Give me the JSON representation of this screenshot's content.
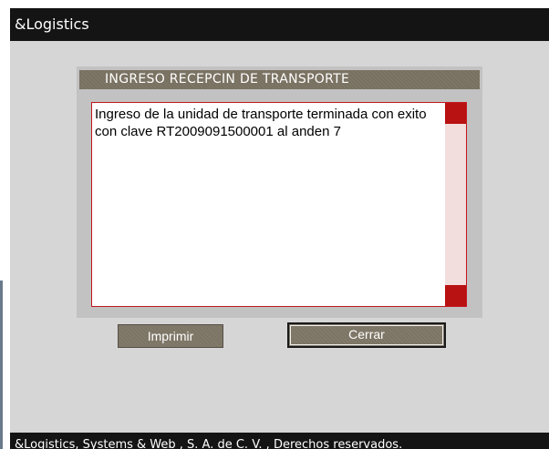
{
  "app": {
    "title": "&Logistics"
  },
  "dialog": {
    "title": "INGRESO RECEPCIN DE TRANSPORTE",
    "message": "Ingreso de la unidad de transporte terminada con exito con clave RT2009091500001 al anden 7"
  },
  "buttons": {
    "print_label": "Imprimir",
    "close_label": "Cerrar"
  },
  "footer": {
    "text": "&Logistics, Systems & Web , S. A. de C. V. , Derechos reservados."
  },
  "colors": {
    "titlebar": "#141414",
    "background": "#d6d6d6",
    "dialog_header": "#787060",
    "accent_red": "#b81212",
    "button": "#7c7464"
  }
}
